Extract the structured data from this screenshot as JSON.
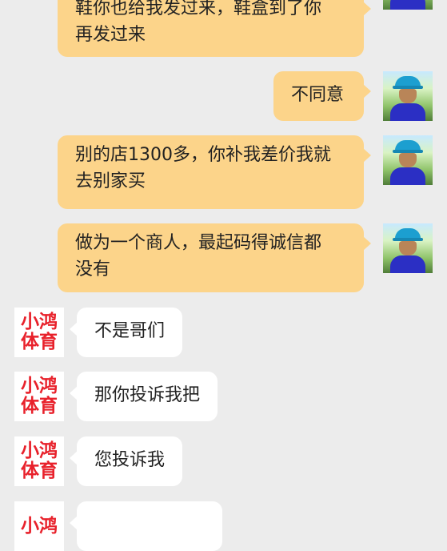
{
  "messages": [
    {
      "from": "me",
      "text": "鞋你也给我发过来，鞋盒到了你\n再发过来"
    },
    {
      "from": "me",
      "text": "不同意"
    },
    {
      "from": "me",
      "text": "别的店1300多，你补我差价我就\n去别家买"
    },
    {
      "from": "me",
      "text": "做为一个商人，最起码得诚信都\n没有"
    },
    {
      "from": "shop",
      "text": "不是哥们"
    },
    {
      "from": "shop",
      "text": "那你投诉我把"
    },
    {
      "from": "shop",
      "text": "您投诉我"
    }
  ],
  "shop_logo": {
    "line1": "小鸿",
    "line2": "体育",
    "color": "#e8212b"
  },
  "colors": {
    "outgoing_bubble": "#fcd48a",
    "incoming_bubble": "#ffffff",
    "background": "#ececec"
  }
}
